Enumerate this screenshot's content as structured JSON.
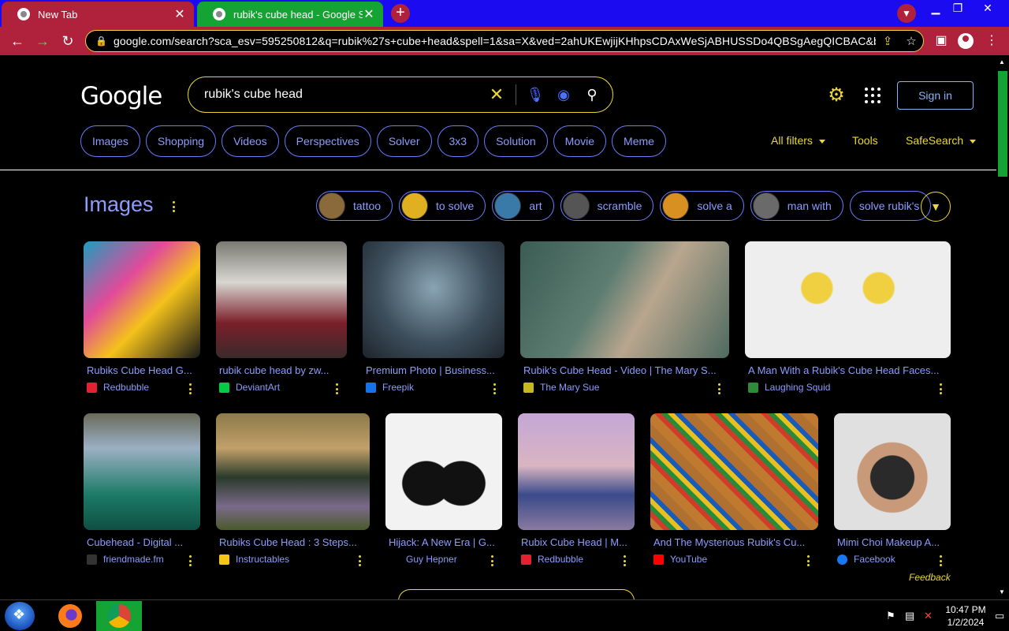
{
  "browser": {
    "tabs": [
      {
        "title": "New Tab",
        "active": false
      },
      {
        "title": "rubik's cube head - Google Search",
        "active": true
      }
    ],
    "new_tab_glyph": "+",
    "url": "google.com/search?sca_esv=595250812&q=rubik%27s+cube+head&spell=1&sa=X&ved=2ahUKEwjijKHhpsCDAxWeSjABHUSSDo4QBSgAegQICBAC&bi...",
    "colors": {
      "tabbar": "#1b0bf0",
      "inactive_tab": "#b0213b",
      "active_tab": "#15a334",
      "omnibox_border": "#e9d73b"
    }
  },
  "google": {
    "logo": "Google",
    "query": "rubik's cube head",
    "sign_in": "Sign in",
    "filter_chips": [
      "Images",
      "Shopping",
      "Videos",
      "Perspectives",
      "Solver",
      "3x3",
      "Solution",
      "Movie",
      "Meme"
    ],
    "all_filters": "All filters",
    "tools": "Tools",
    "safesearch": "SafeSearch",
    "images_heading": "Images",
    "refine_chips": [
      {
        "label": "tattoo",
        "thumb_color": "#8a6a3a"
      },
      {
        "label": "to solve",
        "thumb_color": "#e0b020"
      },
      {
        "label": "art",
        "thumb_color": "#3a7aa8"
      },
      {
        "label": "scramble",
        "thumb_color": "#555555"
      },
      {
        "label": "solve a",
        "thumb_color": "#d89020"
      },
      {
        "label": "man with",
        "thumb_color": "#6a6a6a"
      },
      {
        "label": "solve rubik's",
        "thumb_color": ""
      }
    ],
    "results_row1": [
      {
        "title": "Rubiks Cube Head G...",
        "source": "Redbubble",
        "icon_color": "#e4222f"
      },
      {
        "title": "rubik cube head by zw...",
        "source": "DeviantArt",
        "icon_color": "#05cc47"
      },
      {
        "title": "Premium Photo | Business...",
        "source": "Freepik",
        "icon_color": "#1273eb"
      },
      {
        "title": "Rubik's Cube Head - Video | The Mary S...",
        "source": "The Mary Sue",
        "icon_color": "#c8b820"
      },
      {
        "title": "A Man With a Rubik's Cube Head Faces...",
        "source": "Laughing Squid",
        "icon_color": "#2e8b3a"
      }
    ],
    "results_row2": [
      {
        "title": "Cubehead - Digital ...",
        "source": "friendmade.fm",
        "icon_color": "#333333"
      },
      {
        "title": "Rubiks Cube Head : 3 Steps...",
        "source": "Instructables",
        "icon_color": "#f5c518"
      },
      {
        "title": "Hijack: A New Era | G...",
        "source": "Guy Hepner",
        "icon_color": ""
      },
      {
        "title": "Rubix Cube Head | M...",
        "source": "Redbubble",
        "icon_color": "#e4222f"
      },
      {
        "title": "And The Mysterious Rubik's Cu...",
        "source": "YouTube",
        "icon_color": "#ff0000"
      },
      {
        "title": "Mimi Choi Makeup A...",
        "source": "Facebook",
        "icon_color": "#1877f2"
      }
    ],
    "feedback": "Feedback"
  },
  "taskbar": {
    "time": "10:47 PM",
    "date": "1/2/2024"
  }
}
